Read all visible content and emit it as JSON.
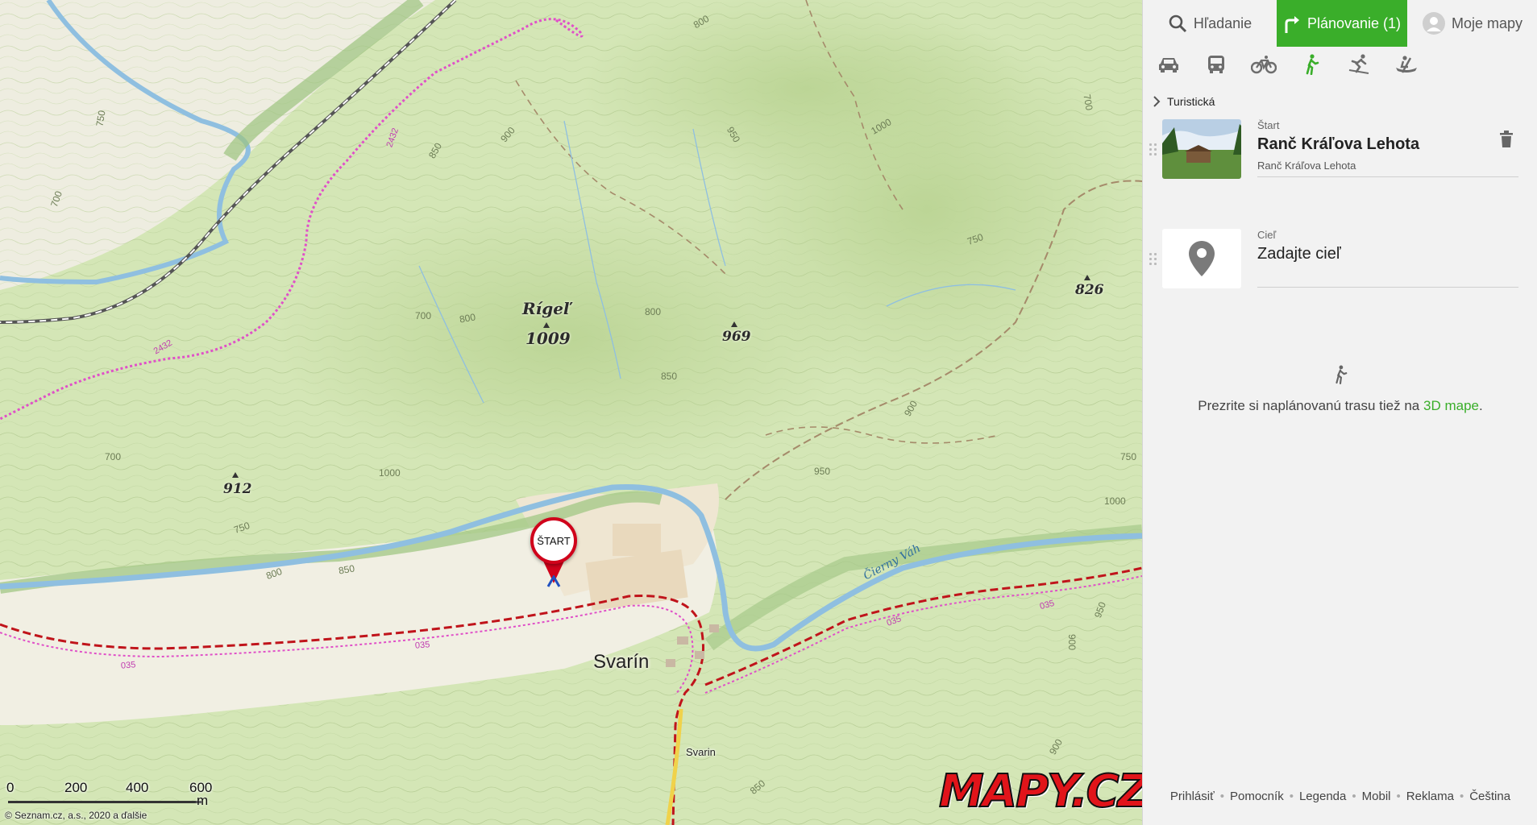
{
  "map": {
    "peaks": [
      {
        "name": "Rígeľ",
        "elevation": "1009"
      },
      {
        "elevation": "969"
      },
      {
        "elevation": "912"
      },
      {
        "elevation": "826"
      }
    ],
    "town": "Svarín",
    "stop_label": "Svarin",
    "river_label": "Čierny Váh",
    "contour_labels": [
      "750",
      "700",
      "800",
      "850",
      "900",
      "950",
      "1000"
    ],
    "route_numbers": [
      "2432",
      "035"
    ],
    "start_pin_label": "ŠTART",
    "scale": {
      "ticks": [
        "0",
        "200",
        "400",
        "600"
      ],
      "unit": "m"
    },
    "copyright": {
      "text": "© Seznam.cz, a.s., 2020 a",
      "link": "ďalšie"
    },
    "logo": "MAPY.CZ",
    "colors": {
      "forest": "#cfe3ad",
      "meadow": "#f1efe2",
      "river": "#8fbfe0",
      "hiking_route": "#c0141b",
      "cycle_route": "#e050c8"
    }
  },
  "panel": {
    "tabs": {
      "search": {
        "label": "Hľadanie",
        "icon": "search-icon"
      },
      "planning": {
        "label": "Plánovanie (1)",
        "icon": "route-icon"
      },
      "my_maps": {
        "label": "Moje mapy",
        "icon": "user-avatar-icon"
      }
    },
    "transport_modes": [
      "car",
      "bus",
      "bike",
      "hike",
      "ski",
      "boat"
    ],
    "active_mode": "hike",
    "route_type": "Turistická",
    "start": {
      "kind": "Štart",
      "title": "Ranč Kráľova Lehota",
      "subtitle": "Ranč Kráľova Lehota"
    },
    "destination": {
      "kind": "Cieľ",
      "placeholder": "Zadajte cieľ"
    },
    "hint": {
      "text": "Prezrite si naplánovanú trasu tiež na",
      "link": "3D mape",
      "suffix": "."
    },
    "footer_links": [
      "Prihlásiť",
      "Pomocník",
      "Legenda",
      "Mobil",
      "Reklama",
      "Čeština"
    ],
    "colors": {
      "accent": "#3aae2a",
      "icon_gray": "#6d6d6d"
    }
  }
}
